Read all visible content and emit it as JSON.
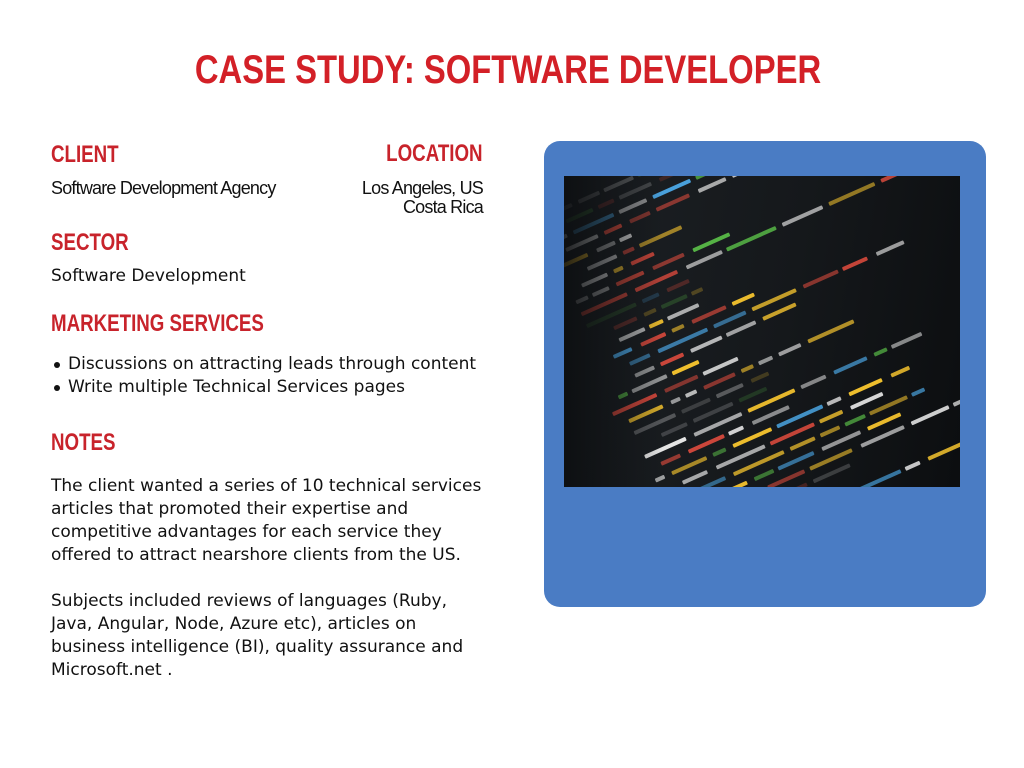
{
  "title": "Case Study: Software Developer",
  "client": {
    "label": "Client",
    "value": "Software Development Agency"
  },
  "location": {
    "label": "Location",
    "line1": "Los Angeles, US",
    "line2": "Costa Rica"
  },
  "sector": {
    "label": "Sector",
    "value": "Software Development"
  },
  "marketing_services": {
    "label": "Marketing Services",
    "items": [
      "Discussions on attracting leads through content",
      "Write multiple Technical Services pages"
    ]
  },
  "notes": {
    "label": "Notes",
    "paragraphs": [
      "The client wanted a series of 10 technical services articles that promoted their expertise and competitive advantages for each service they offered to attract nearshore clients from the US.",
      "Subjects included reviews of languages (Ruby, Java, Angular, Node, Azure  etc), articles on business intelligence (BI), quality assurance and Microsoft.net ."
    ]
  },
  "image": {
    "icon": "code-screenshot-photo",
    "panel_color": "#4a7cc4"
  },
  "colors": {
    "accent": "#d32027",
    "text": "#111111",
    "background": "#ffffff"
  }
}
